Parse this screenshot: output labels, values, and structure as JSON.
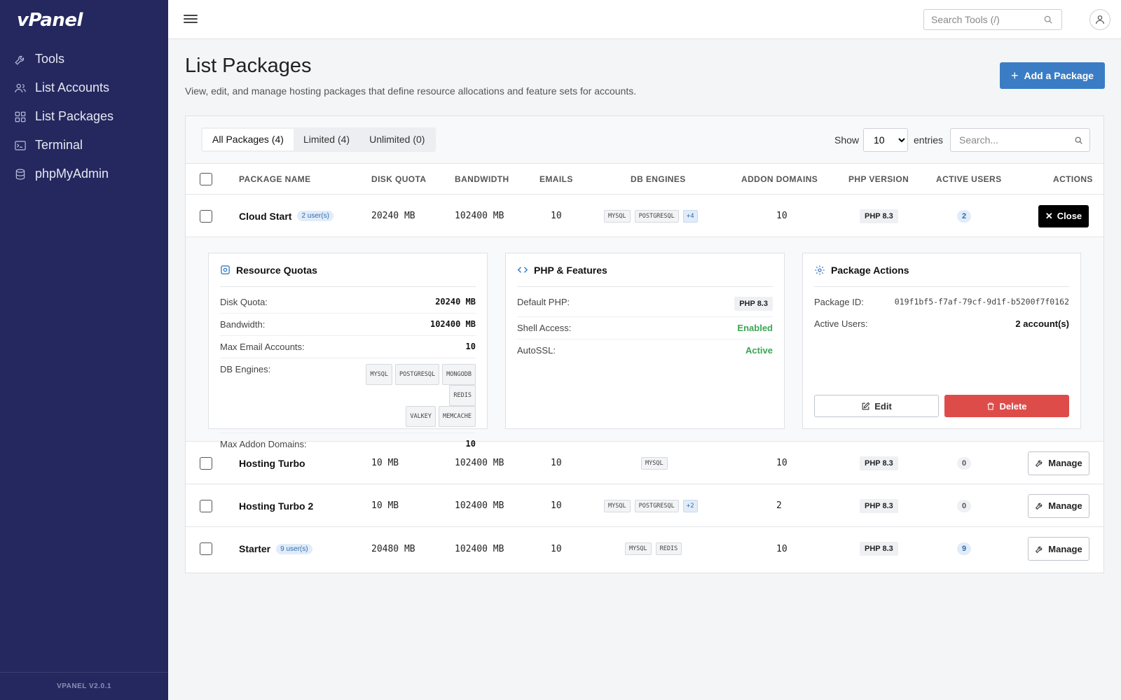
{
  "app": {
    "logo": "vPanel",
    "version": "VPANEL V2.0.1"
  },
  "sidebar": {
    "items": [
      {
        "label": "Tools",
        "icon": "wrench-icon"
      },
      {
        "label": "List Accounts",
        "icon": "users-icon"
      },
      {
        "label": "List Packages",
        "icon": "grid-icon"
      },
      {
        "label": "Terminal",
        "icon": "terminal-icon"
      },
      {
        "label": "phpMyAdmin",
        "icon": "database-icon"
      }
    ]
  },
  "topbar": {
    "search_placeholder": "Search Tools (/)"
  },
  "header": {
    "title": "List Packages",
    "subtitle": "View, edit, and manage hosting packages that define resource allocations and feature sets for accounts.",
    "add_button": "Add a Package"
  },
  "filters": {
    "tabs": [
      {
        "label": "All Packages (4)",
        "active": true
      },
      {
        "label": "Limited (4)",
        "active": false
      },
      {
        "label": "Unlimited (0)",
        "active": false
      }
    ],
    "show_label": "Show",
    "entries_value": "10",
    "entries_label": "entries",
    "search_placeholder": "Search..."
  },
  "table": {
    "columns": [
      "PACKAGE NAME",
      "DISK QUOTA",
      "BANDWIDTH",
      "EMAILS",
      "DB ENGINES",
      "ADDON DOMAINS",
      "PHP VERSION",
      "ACTIVE USERS",
      "ACTIONS"
    ],
    "rows": [
      {
        "name": "Cloud Start",
        "users_badge": "2 user(s)",
        "disk": "20240 MB",
        "bandwidth": "102400 MB",
        "emails": "10",
        "db": [
          "MYSQL",
          "POSTGRESQL"
        ],
        "db_more": "+4",
        "addon": "10",
        "php": "PHP 8.3",
        "active": "2",
        "action": "Close"
      },
      {
        "name": "Hosting Turbo",
        "users_badge": "",
        "disk": "10 MB",
        "bandwidth": "102400 MB",
        "emails": "10",
        "db": [
          "MYSQL"
        ],
        "db_more": "",
        "addon": "10",
        "php": "PHP 8.3",
        "active": "0",
        "action": "Manage"
      },
      {
        "name": "Hosting Turbo 2",
        "users_badge": "",
        "disk": "10 MB",
        "bandwidth": "102400 MB",
        "emails": "10",
        "db": [
          "MYSQL",
          "POSTGRESQL"
        ],
        "db_more": "+2",
        "addon": "2",
        "php": "PHP 8.3",
        "active": "0",
        "action": "Manage"
      },
      {
        "name": "Starter",
        "users_badge": "9 user(s)",
        "disk": "20480 MB",
        "bandwidth": "102400 MB",
        "emails": "10",
        "db": [
          "MYSQL",
          "REDIS"
        ],
        "db_more": "",
        "addon": "10",
        "php": "PHP 8.3",
        "active": "9",
        "action": "Manage"
      }
    ]
  },
  "detail": {
    "quotas": {
      "title": "Resource Quotas",
      "disk_label": "Disk Quota:",
      "disk": "20240 MB",
      "bw_label": "Bandwidth:",
      "bw": "102400 MB",
      "email_label": "Max Email Accounts:",
      "email": "10",
      "db_label": "DB Engines:",
      "db": [
        "MYSQL",
        "POSTGRESQL",
        "MONGODB",
        "REDIS",
        "VALKEY",
        "MEMCACHE"
      ],
      "addon_label": "Max Addon Domains:",
      "addon": "10"
    },
    "php": {
      "title": "PHP & Features",
      "default_label": "Default PHP:",
      "default": "PHP 8.3",
      "shell_label": "Shell Access:",
      "shell": "Enabled",
      "ssl_label": "AutoSSL:",
      "ssl": "Active"
    },
    "actions": {
      "title": "Package Actions",
      "id_label": "Package ID:",
      "id": "019f1bf5-f7af-79cf-9d1f-b5200f7f0162",
      "users_label": "Active Users:",
      "users": "2 account(s)",
      "edit": "Edit",
      "delete": "Delete"
    }
  },
  "colors": {
    "sidebar": "#25285e",
    "primary": "#3b7dc4",
    "danger": "#de4c4a",
    "success": "#3aa655"
  }
}
